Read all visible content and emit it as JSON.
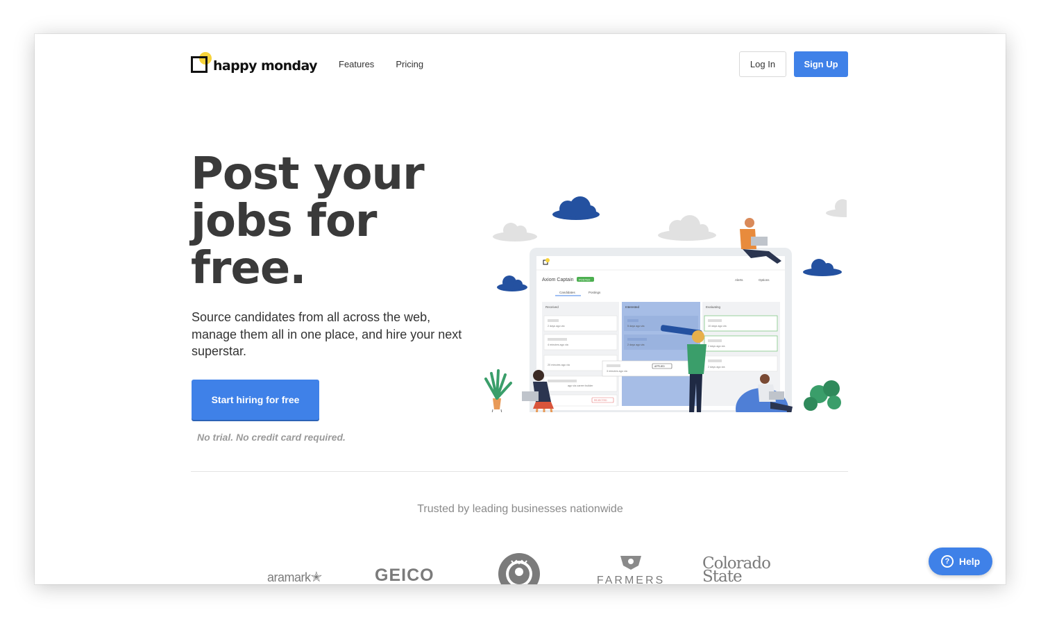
{
  "header": {
    "logo_text": "happy monday",
    "nav": [
      "Features",
      "Pricing"
    ],
    "login_label": "Log In",
    "signup_label": "Sign Up"
  },
  "hero": {
    "title_lines": [
      "Post your",
      "jobs for",
      "free."
    ],
    "subtitle": "Source candidates from all across the web, manage them all in one place, and hire your next superstar.",
    "cta_label": "Start hiring for free",
    "note": "No trial. No credit card required."
  },
  "illustration": {
    "app_title": "Axiom Captain",
    "app_badge": "POSTED",
    "tabs": [
      "Candidates",
      "Postings"
    ],
    "menus": [
      "Alerts",
      "Options"
    ],
    "columns": [
      {
        "name": "Received",
        "count": "0",
        "cards": [
          "2 days ago via",
          "4 minutes ago via",
          "20 minutes ago via",
          "ago via career builder",
          "ago via"
        ]
      },
      {
        "name": "Interested",
        "count": "0",
        "cards": [
          "5 days ago via",
          "2 days ago via"
        ]
      },
      {
        "name": "Evaluating",
        "count": "0",
        "cards": [
          "10 days ago via",
          "2 days ago via",
          "2 days ago via"
        ]
      }
    ],
    "drag_card": {
      "text": "3 minutes ago via",
      "tag": "APPLIED"
    },
    "tag_rejected": "REJECTED"
  },
  "trusted": {
    "heading": "Trusted by leading businesses nationwide",
    "logos": [
      "aramark",
      "GEICO",
      "starbucks",
      "FARMERS",
      "Colorado State"
    ]
  },
  "help": {
    "label": "Help",
    "icon": "question-icon"
  },
  "colors": {
    "accent": "#3f81e8",
    "logo_sun": "#f7d33b",
    "title": "#3a3a3a"
  }
}
